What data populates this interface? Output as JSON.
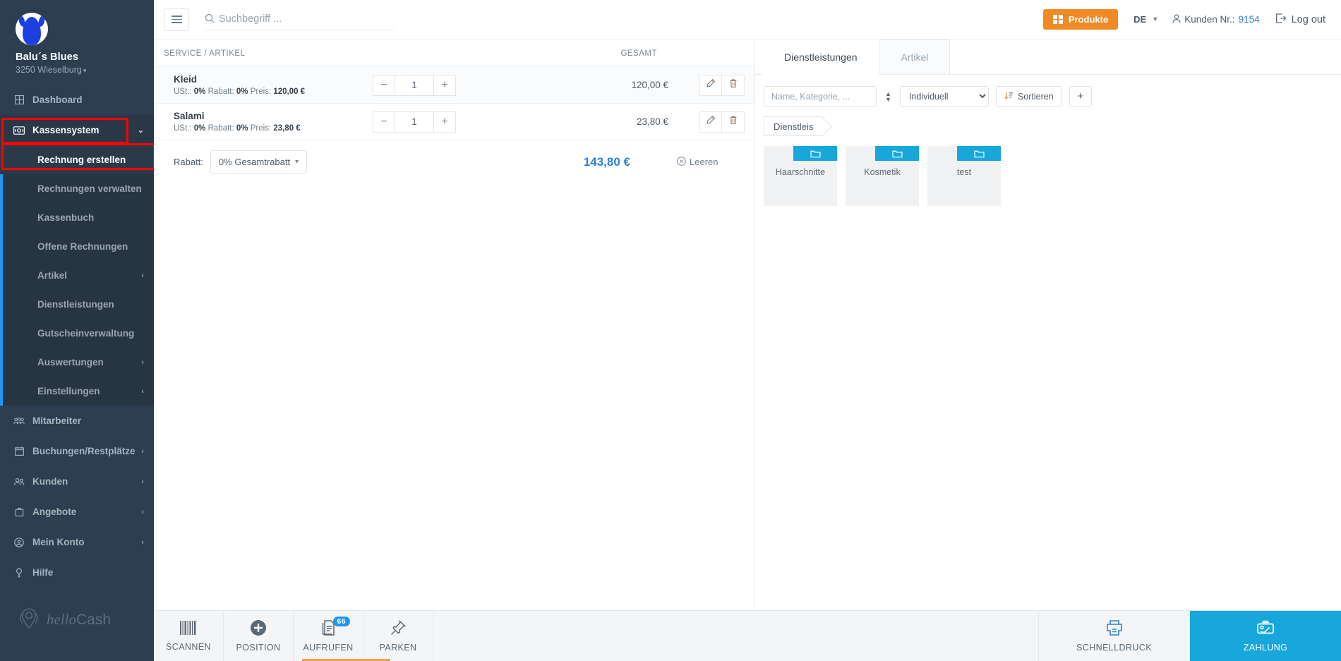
{
  "sidebar": {
    "brand": {
      "name": "Balu´s Blues",
      "location": "3250 Wieselburg",
      "caret": "▾"
    },
    "items": [
      {
        "label": "Dashboard",
        "icon": "dashboard-grid-icon",
        "chevron": ""
      },
      {
        "label": "Kassensystem",
        "icon": "cash-register-icon",
        "chevron": "⌄"
      }
    ],
    "submenu": [
      {
        "label": "Rechnung erstellen",
        "active": true,
        "chevron": ""
      },
      {
        "label": "Rechnungen verwalten",
        "active": false,
        "chevron": ""
      },
      {
        "label": "Kassenbuch",
        "active": false,
        "chevron": ""
      },
      {
        "label": "Offene Rechnungen",
        "active": false,
        "chevron": ""
      },
      {
        "label": "Artikel",
        "active": false,
        "chevron": "‹"
      },
      {
        "label": "Dienstleistungen",
        "active": false,
        "chevron": ""
      },
      {
        "label": "Gutscheinverwaltung",
        "active": false,
        "chevron": ""
      },
      {
        "label": "Auswertungen",
        "active": false,
        "chevron": "‹"
      },
      {
        "label": "Einstellungen",
        "active": false,
        "chevron": "‹"
      }
    ],
    "items_lower": [
      {
        "label": "Mitarbeiter",
        "icon": "employees-icon",
        "chevron": ""
      },
      {
        "label": "Buchungen/Restplätze",
        "icon": "calendar-icon",
        "chevron": "‹"
      },
      {
        "label": "Kunden",
        "icon": "customers-icon",
        "chevron": "‹"
      },
      {
        "label": "Angebote",
        "icon": "offers-briefcase-icon",
        "chevron": "‹"
      },
      {
        "label": "Mein Konto",
        "icon": "account-circle-icon",
        "chevron": "‹"
      },
      {
        "label": "Hilfe",
        "icon": "help-icon",
        "chevron": ""
      }
    ],
    "logo": {
      "italic": "hello",
      "normal": "Cash"
    }
  },
  "topbar": {
    "menu_toggle": "hamburger-icon",
    "search": {
      "placeholder": "Suchbegriff ...",
      "value": "",
      "icon": "search-icon"
    },
    "produkte_label": "Produkte",
    "language": "DE",
    "customer_label": "Kunden Nr.:",
    "customer_number": "9154",
    "logout_label": "Log out"
  },
  "cart": {
    "columns": {
      "name": "SERVICE / ARTIKEL",
      "total": "GESAMT",
      "actions": ""
    },
    "rows": [
      {
        "name": "Kleid",
        "meta_ust_label": "USt.:",
        "meta_ust": "0%",
        "meta_rabatt_label": "Rabatt:",
        "meta_rabatt": "0%",
        "meta_preis_label": "Preis:",
        "meta_preis": "120,00 €",
        "qty": "1",
        "total": "120,00 €",
        "minus": "−",
        "plus": "+"
      },
      {
        "name": "Salami",
        "meta_ust_label": "USt.:",
        "meta_ust": "0%",
        "meta_rabatt_label": "Rabatt:",
        "meta_rabatt": "0%",
        "meta_preis_label": "Preis:",
        "meta_preis": "23,80 €",
        "qty": "1",
        "total": "23,80 €",
        "minus": "−",
        "plus": "+"
      }
    ],
    "summary": {
      "discount_label": "Rabatt:",
      "discount_select": "0% Gesamtrabatt",
      "discount_caret": "⌄",
      "total": "143,80 €",
      "clear_label": "Leeren"
    }
  },
  "catalog": {
    "tabs": [
      {
        "label": "Dienstleistungen",
        "active": true
      },
      {
        "label": "Artikel",
        "active": false
      }
    ],
    "search_placeholder": "Name, Kategorie, ...",
    "search_value": "",
    "select_value": "Individuell",
    "select_options": [
      "Individuell"
    ],
    "sort_label": "Sortieren",
    "add_label": "+",
    "breadcrumb": "Dienstleis",
    "tiles": [
      {
        "label": "Haarschnitte"
      },
      {
        "label": "Kosmetik"
      },
      {
        "label": "test"
      }
    ]
  },
  "bottombar": {
    "left": [
      {
        "label": "SCANNEN",
        "icon": "barcode-icon",
        "badge": ""
      },
      {
        "label": "POSITION",
        "icon": "plus-circle-icon",
        "badge": ""
      },
      {
        "label": "AUFRUFEN",
        "icon": "documents-icon",
        "badge": "66"
      },
      {
        "label": "PARKEN",
        "icon": "pin-icon",
        "badge": ""
      }
    ],
    "right": [
      {
        "label": "SCHNELLDRUCK",
        "icon": "printer-icon",
        "primary": false
      },
      {
        "label": "ZAHLUNG",
        "icon": "payment-hand-icon",
        "primary": true
      }
    ]
  },
  "colors": {
    "sidebar_bg": "#2c3e50",
    "accent_blue": "#17a7db",
    "link_blue": "#2b82d4",
    "orange": "#f08a24",
    "highlight_red": "#fb0007"
  }
}
